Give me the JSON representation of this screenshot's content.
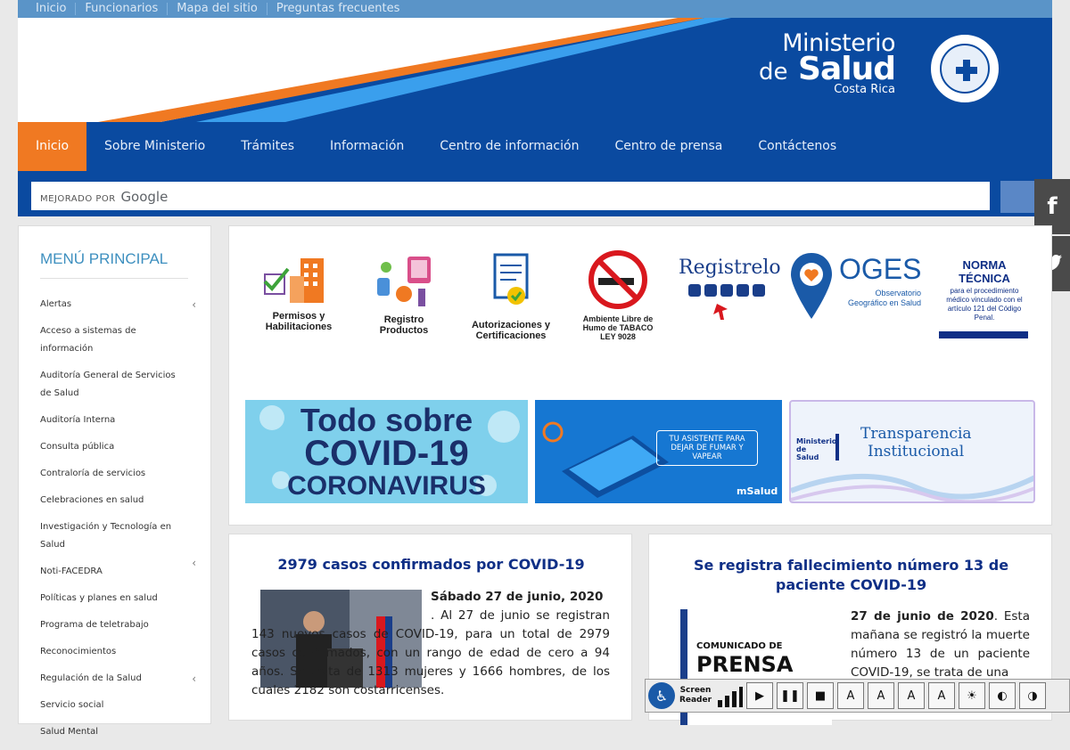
{
  "topbar": {
    "links": [
      "Inicio",
      "Funcionarios",
      "Mapa del sitio",
      "Preguntas frecuentes"
    ]
  },
  "brand": {
    "line1": "Ministerio",
    "line2a": "de",
    "line2b": "Salud",
    "line3": "Costa Rica"
  },
  "nav": {
    "items": [
      "Inicio",
      "Sobre Ministerio",
      "Trámites",
      "Información",
      "Centro de información",
      "Centro de prensa",
      "Contáctenos"
    ]
  },
  "search": {
    "powered_by": "MEJORADO POR",
    "google": "Google"
  },
  "social": {
    "facebook": "f",
    "twitter": "🐦"
  },
  "sidebar": {
    "title": "MENÚ PRINCIPAL",
    "items": [
      "Alertas",
      "Acceso a sistemas de información",
      "Auditoría General de Servicios de Salud",
      "Auditoría Interna",
      "Consulta pública",
      "Contraloría de servicios",
      "Celebraciones en salud",
      "Investigación y Tecnología en Salud",
      "Noti-FACEDRA",
      "Políticas y planes en salud",
      "Programa de teletrabajo",
      "Reconocimientos",
      "Regulación de la Salud",
      "Servicio social",
      "Salud Mental"
    ]
  },
  "shortcuts": {
    "permisos": "Permisos y Habilitaciones",
    "registro": "Registro Productos",
    "autorizaciones": "Autorizaciones y Certificaciones",
    "tabaco1": "Ambiente Libre de Humo de TABACO",
    "tabaco2": "LEY 9028",
    "registrelo": "Registrelo",
    "oges": "OGES",
    "oges_sub": "Observatorio Geográfico en Salud",
    "norma_title": "NORMA TÉCNICA",
    "norma_sub": "para el procedimiento médico vinculado con el artículo 121 del Código Penal."
  },
  "banners": {
    "covid_l1": "Todo sobre",
    "covid_l2": "COVID-19",
    "covid_l3": "CORONAVIRUS",
    "fumar": "TU ASISTENTE PARA DEJAR DE FUMAR Y VAPEAR",
    "msalud": "mSalud",
    "trans_l1": "Transparencia",
    "trans_l2": "Institucional",
    "trans_logo": "Ministerio de Salud"
  },
  "news1": {
    "title": "2979 casos confirmados por COVID-19",
    "date": "Sábado 27 de junio, 2020",
    "text": ". Al 27 de junio se registran 143 nuevos casos de COVID-19, para un total de 2979 casos confirmados, con un rango de edad de cero a 94 años. Se trata de 1313 mujeres y 1666 hombres, de los cuales 2182 son costarricenses."
  },
  "news2": {
    "title": "Se registra fallecimiento número 13 de paciente COVID-19",
    "date": "27 de junio de 2020",
    "text": ". Esta mañana se registró la muerte número 13 de un paciente COVID-19, se trata de una",
    "img_l1": "COMUNICADO DE",
    "img_l2": "PRENSA"
  },
  "reader": {
    "label1": "Screen",
    "label2": "Reader"
  },
  "colors": {
    "nav_blue": "#0a4aa0",
    "accent_orange": "#f07922",
    "sky": "#3fa9f5",
    "link_top": "#5a94c8"
  }
}
